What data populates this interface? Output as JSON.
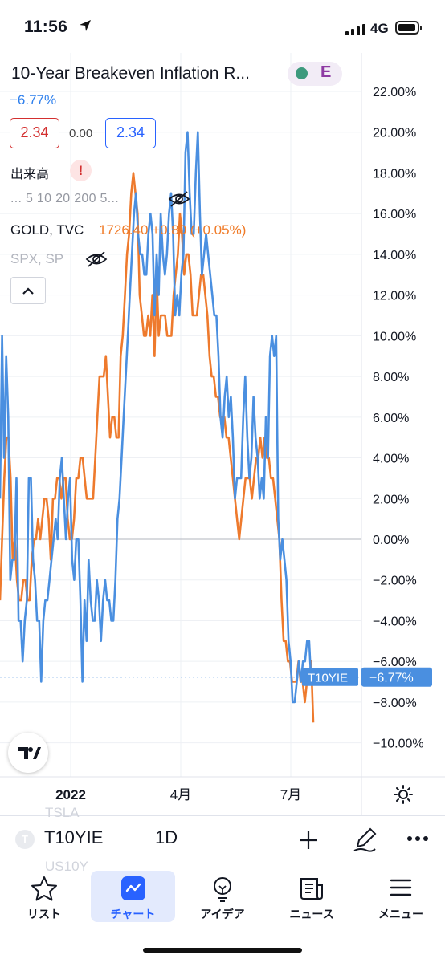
{
  "status": {
    "time": "11:56",
    "network": "4G"
  },
  "chart_header": {
    "title": "10-Year Breakeven Inflation R...",
    "badge": "E",
    "change_pct": "−6.77%",
    "bid": "2.34",
    "spread": "0.00",
    "ask": "2.34",
    "volume_label": "出来高",
    "warning_glyph": "!",
    "ma_lengths": "...   5  10  20  200  5...",
    "compare_symbol": "GOLD, TVC",
    "compare_values": "1726.40  +0.80 (+0.05%)",
    "hidden_symbol": "SPX, SP"
  },
  "chart_data": {
    "type": "line",
    "x_ticks": [
      "2022",
      "4月",
      "7月"
    ],
    "y_ticks": [
      "22.00%",
      "20.00%",
      "18.00%",
      "16.00%",
      "14.00%",
      "12.00%",
      "10.00%",
      "8.00%",
      "6.00%",
      "4.00%",
      "2.00%",
      "0.00%",
      "−2.00%",
      "−4.00%",
      "−6.00%",
      "−8.00%",
      "−10.00%"
    ],
    "ylim": [
      -10,
      22
    ],
    "last_label": {
      "symbol": "T10YIE",
      "value": "−6.77%"
    },
    "series": [
      {
        "name": "T10YIE",
        "color": "#4a8fe0",
        "values": [
          2,
          10,
          4,
          9,
          6,
          -2,
          -1,
          -1,
          3,
          -4,
          -4,
          -6,
          -4,
          -3,
          3,
          3,
          -1,
          -2,
          -4,
          -4,
          -7,
          -4,
          -3,
          -3,
          -2,
          -1,
          0,
          1,
          0,
          3,
          4,
          2,
          0,
          2,
          3,
          -1,
          -2,
          0,
          0,
          -3,
          -7,
          -3,
          -5,
          -1,
          -3,
          -4,
          -4,
          -2,
          -3,
          -5,
          -3,
          -2,
          -3,
          -3,
          -4,
          -4,
          -2,
          1,
          2,
          4,
          6,
          8,
          10,
          12,
          14,
          16,
          17,
          15,
          14,
          14,
          13,
          13,
          15,
          16,
          15,
          11,
          14,
          12,
          16,
          14,
          13,
          14,
          16,
          17,
          15,
          11,
          12,
          11,
          13,
          14,
          19,
          20,
          17,
          15,
          15,
          18,
          20,
          16,
          13,
          14,
          15,
          14,
          13,
          12,
          11,
          11,
          9,
          6,
          5,
          7,
          8,
          6,
          7,
          5,
          2,
          3,
          3,
          3,
          6,
          8,
          5,
          3,
          4,
          7,
          5,
          4,
          2,
          3,
          2,
          6,
          4,
          9,
          10,
          9,
          10,
          1,
          -1,
          0,
          -1,
          -2,
          -5,
          -6,
          -8,
          -8,
          -7,
          -6,
          -7,
          -6,
          -6,
          -5,
          -5,
          -7,
          -7
        ]
      },
      {
        "name": "GOLD",
        "color": "#ee7a2d",
        "values": [
          -3,
          0,
          3,
          5,
          5,
          3,
          -1,
          0,
          -2,
          -3,
          -3,
          -2,
          -2,
          -3,
          -3,
          -1,
          0,
          0,
          1,
          0,
          1,
          2,
          2,
          1,
          -1,
          2,
          2,
          3,
          3,
          2,
          3,
          3,
          1,
          0,
          0,
          1,
          3,
          3,
          4,
          4,
          3,
          2,
          2,
          2,
          2,
          4,
          6,
          8,
          8,
          8,
          9,
          7,
          5,
          6,
          6,
          5,
          5,
          9,
          10,
          12,
          14,
          15,
          17,
          18,
          17,
          16,
          12,
          11,
          10,
          10,
          11,
          10,
          12,
          9,
          13,
          10,
          11,
          11,
          11,
          10,
          10,
          10,
          12,
          13,
          14,
          16,
          15,
          13,
          14,
          14,
          13,
          11,
          11,
          11,
          12,
          13,
          13,
          12,
          11,
          9,
          8,
          8,
          7,
          7,
          6,
          6,
          6,
          5,
          5,
          4,
          3,
          2,
          1,
          0,
          1,
          2,
          3,
          3,
          3,
          2,
          3,
          4,
          4,
          5,
          4,
          5,
          4,
          4,
          3,
          3,
          2,
          1,
          0,
          -3,
          -5,
          -5,
          -6,
          -6,
          -7,
          -7,
          -7,
          -6,
          -7,
          -7,
          -8,
          -7,
          -7,
          -6,
          -9
        ]
      }
    ]
  },
  "toolbar": {
    "symbol_initial": "T",
    "symbol": "T10YIE",
    "interval": "1D",
    "ghost_above": "TSLA",
    "ghost_below": "US10Y"
  },
  "tabs": [
    {
      "label": "リスト",
      "icon": "star-icon"
    },
    {
      "label": "チャート",
      "icon": "chart-icon"
    },
    {
      "label": "アイデア",
      "icon": "lightbulb-icon"
    },
    {
      "label": "ニュース",
      "icon": "news-icon"
    },
    {
      "label": "メニュー",
      "icon": "menu-icon"
    }
  ],
  "colors": {
    "accent": "#2962ff",
    "up": "#26a69a",
    "down": "#d32f2f"
  }
}
